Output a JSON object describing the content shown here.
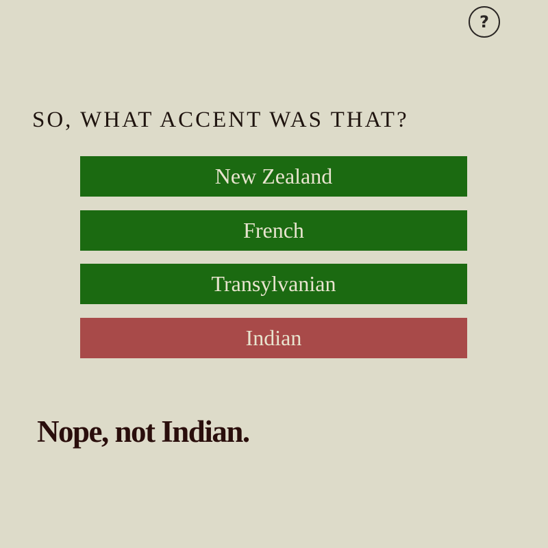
{
  "header": {
    "help_glyph": "?",
    "help_icon": "question-mark-circle-icon"
  },
  "quiz": {
    "question": "SO, WHAT ACCENT WAS THAT?",
    "answers": [
      {
        "label": "New Zealand",
        "state": "correct-color",
        "color": "#1b6a11"
      },
      {
        "label": "French",
        "state": "correct-color",
        "color": "#1b6a11"
      },
      {
        "label": "Transylvanian",
        "state": "correct-color",
        "color": "#1b6a11"
      },
      {
        "label": "Indian",
        "state": "selected-wrong",
        "color": "#a84a49"
      }
    ],
    "feedback": "Nope, not Indian."
  },
  "colors": {
    "background": "#dddbc9",
    "green": "#1b6a11",
    "red": "#a84a49",
    "text_dark": "#1f140f"
  }
}
